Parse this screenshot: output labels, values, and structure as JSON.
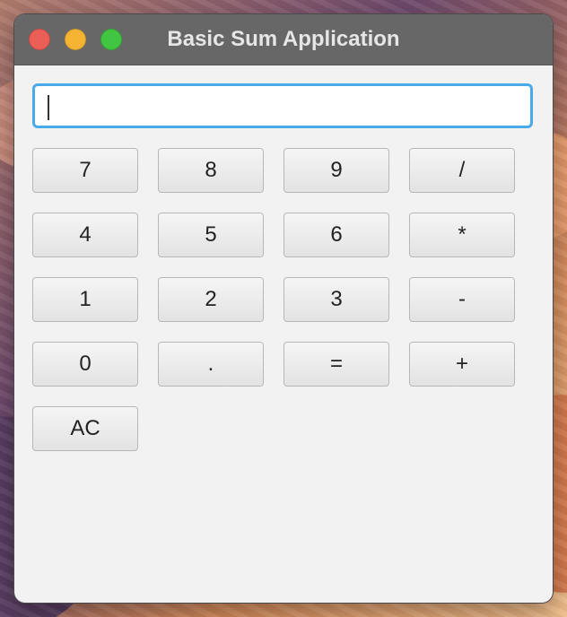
{
  "window": {
    "title": "Basic Sum Application"
  },
  "display": {
    "value": "",
    "placeholder": ""
  },
  "buttons": {
    "row1": [
      "7",
      "8",
      "9",
      "/"
    ],
    "row2": [
      "4",
      "5",
      "6",
      "*"
    ],
    "row3": [
      "1",
      "2",
      "3",
      "-"
    ],
    "row4": [
      "0",
      ".",
      "=",
      "+"
    ],
    "clear": "AC"
  },
  "colors": {
    "close": "#ec5f57",
    "minimize": "#f5b532",
    "zoom": "#42c542",
    "titlebar": "#676767",
    "focus_ring": "#4aa9e8"
  },
  "icons": {
    "close": "close-window-icon",
    "minimize": "minimize-window-icon",
    "zoom": "zoom-window-icon"
  }
}
